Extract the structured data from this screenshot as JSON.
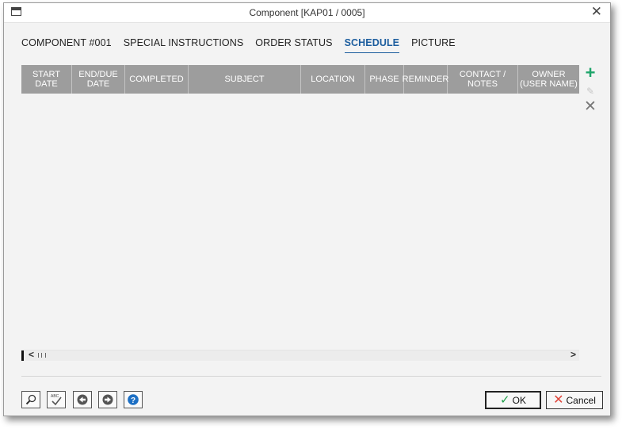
{
  "window": {
    "title": "Component [KAP01 / 0005]",
    "close_glyph": "✕",
    "icon": "window-icon"
  },
  "tabs": [
    {
      "label": "COMPONENT #001",
      "active": false
    },
    {
      "label": "SPECIAL INSTRUCTIONS",
      "active": false
    },
    {
      "label": "ORDER STATUS",
      "active": false
    },
    {
      "label": "SCHEDULE",
      "active": true
    },
    {
      "label": "PICTURE",
      "active": false
    }
  ],
  "grid": {
    "columns": [
      "START DATE",
      "END/DUE DATE",
      "COMPLETED",
      "SUBJECT",
      "LOCATION",
      "PHASE",
      "REMINDER",
      "CONTACT / NOTES",
      "OWNER (USER NAME)"
    ],
    "rows": []
  },
  "side_tools": {
    "add": "+",
    "edit": "✎",
    "delete": "✕"
  },
  "scrollbar": {
    "left_arrow": "<",
    "right_arrow": ">"
  },
  "bottom_toolbar": {
    "icons": [
      "search-icon",
      "spellcheck-icon",
      "previous-icon",
      "next-icon",
      "help-icon"
    ],
    "spell_abc": "ABC",
    "help_glyph": "?"
  },
  "dialog_buttons": {
    "ok_label": "OK",
    "cancel_label": "Cancel",
    "ok_icon": "✓",
    "cancel_icon": "✕"
  },
  "colors": {
    "accent": "#1c5d9e",
    "header_bg": "#9d9d9d",
    "add_green": "#1fa56b",
    "cancel_red": "#e0453a"
  }
}
